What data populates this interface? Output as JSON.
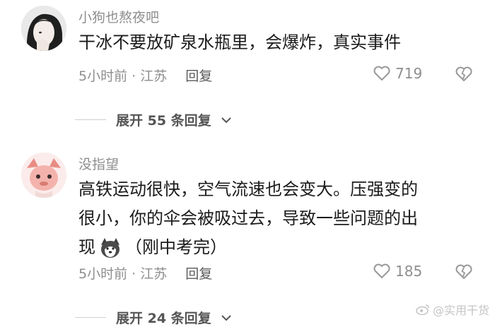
{
  "comments": [
    {
      "username": "小狗也熬夜吧",
      "content": "干冰不要放矿泉水瓶里，会爆炸，真实事件",
      "time_location": "5小时前 · 江苏",
      "reply_label": "回复",
      "like_count": "719",
      "expand_label": "展开 55 条回复"
    },
    {
      "username": "没指望",
      "content_line1": "高铁运动很快，空气流速也会变大。压强变的",
      "content_line2": "很小，你的伞会被吸过去，导致一些问题的出",
      "content_line3_prefix": "现",
      "content_line3_suffix": "（刚中考完）",
      "time_location": "5小时前 · 江苏",
      "reply_label": "回复",
      "like_count": "185",
      "expand_label": "展开 24 条回复"
    }
  ],
  "icons": {
    "like": "heart-outline-icon",
    "dislike": "broken-heart-icon",
    "expand": "chevron-down-icon",
    "emoji": "husky-dog-emoji"
  },
  "watermark": {
    "text": "@实用干货"
  },
  "colors": {
    "text_primary": "#1b1b1b",
    "text_secondary": "#8e8e8e"
  }
}
